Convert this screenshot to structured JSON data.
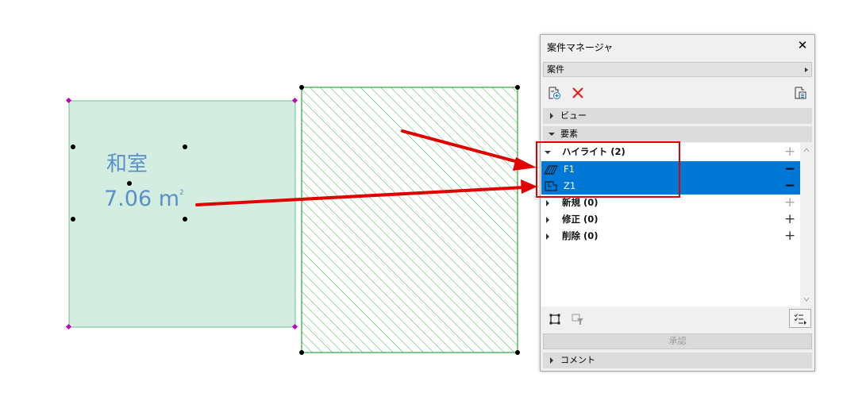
{
  "room": {
    "name": "和室",
    "area_value": "7.06 m",
    "area_unit_sup": "2"
  },
  "panel": {
    "title": "案件マネージャ",
    "close_symbol": "✕",
    "dropdown_value": "案件",
    "sections": {
      "view": "ビュー",
      "elements": "要素",
      "comment": "コメント"
    },
    "rows": {
      "highlight": "ハイライト (2)",
      "f1": "F1",
      "z1": "Z1",
      "new": "新規 (0)",
      "modified": "修正 (0)",
      "deleted": "削除 (0)"
    },
    "signs": {
      "plus": "+",
      "minus": "−"
    },
    "approve_label": "承認"
  },
  "colors": {
    "selection": "#0078d7",
    "annotation_red": "#e00000",
    "room_fill": "#d4ede1",
    "hatch_green": "#3fb24a",
    "room_text": "#5b8fc8"
  },
  "icons": {
    "new_issue": "new-issue-icon",
    "delete": "red-x-delete-icon",
    "issue_options": "issue-list-icon",
    "slab": "slab-element-icon",
    "zone": "zone-element-icon",
    "select_all": "select-rectangle-icon",
    "filter": "filter-icon",
    "list_view": "list-view-icon"
  }
}
